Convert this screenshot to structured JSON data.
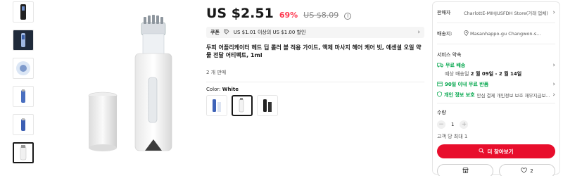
{
  "product": {
    "price": "US $2.51",
    "discount": "69%",
    "original_price": "US $8.09",
    "coupon": {
      "tag": "쿠폰",
      "text": "US $1.01 이상의 US $1.00 할인"
    },
    "title": "두피 어플리케이터 헤드 딥 롤러 볼 적용 가이드, 액체 마사지 헤어 케어 빗, 에센셜 오일 약물 전달 어티팩트, 1ml",
    "sold": "2 개 판매",
    "color_label": "Color:",
    "color_value": "White"
  },
  "panel": {
    "seller_label": "판매자",
    "seller_value": "CharlottE-MIHJUSFDH Store(거래 업체)",
    "shipping_label": "배송지:",
    "shipping_value": "Masanhappo-gu Changwon-s...",
    "service_title": "서비스 약속",
    "free_shipping": "무료 배송",
    "delivery_prefix": "예상 배송일",
    "delivery_dates": "2 월 09일 - 2 월 14일",
    "free_return": "90일 이내 무료 반품",
    "privacy": "개인 정보 보호",
    "privacy_desc": "안심 결제 개인정보 보호 재무지급보...",
    "qty_label": "수량",
    "qty_value": "1",
    "limit": "고객 당 최대 1",
    "buy_button": "더 찾아보기",
    "wish_count": "2"
  },
  "colors": {
    "accent": "#e80e2c",
    "green": "#00a54a",
    "discount": "#fd384f"
  },
  "icons": [
    "info-icon",
    "coupon-tag-icon",
    "chevron-right-icon",
    "location-pin-icon",
    "truck-icon",
    "return-box-icon",
    "shield-icon",
    "minus-icon",
    "plus-icon",
    "search-icon",
    "store-icon",
    "heart-icon"
  ]
}
